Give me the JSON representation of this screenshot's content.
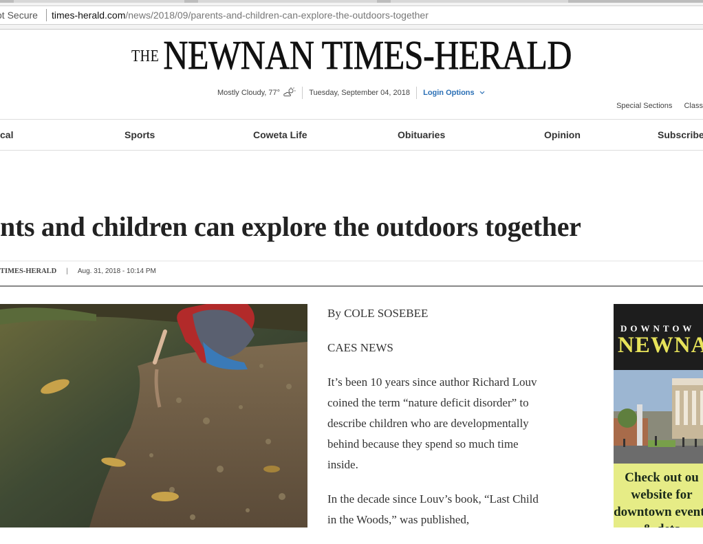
{
  "browser": {
    "security_label": "ot Secure",
    "url_host": "times-herald.com",
    "url_path": "/news/2018/09/parents-and-children-can-explore-the-outdoors-together"
  },
  "masthead": {
    "logo_prefix": "THE",
    "logo_name": "NEWNAN TIMES-HERALD",
    "weather": "Mostly Cloudy, 77°",
    "date": "Tuesday, September 04, 2018",
    "login": "Login Options",
    "utility_links": [
      "Special Sections",
      "Class"
    ]
  },
  "nav": {
    "items": [
      "cal",
      "Sports",
      "Coweta Life",
      "Obituaries",
      "Opinion",
      "Subscribe"
    ]
  },
  "article": {
    "headline": "nts and children can explore the outdoors together",
    "source": "TIMES-HERALD",
    "separator": "|",
    "timestamp": "Aug. 31, 2018 - 10:14 PM",
    "paragraphs": [
      "By COLE SOSEBEE",
      "CAES NEWS",
      "It’s been 10 years since author Richard Louv coined the term “nature deficit disorder” to describe children who are developmentally behind because they spend so much time inside.",
      "In the decade since Louv’s book, “Last Child in the Woods,” was published,"
    ]
  },
  "ad": {
    "kicker": "DOWNTOW",
    "title": "NEWNA",
    "text": "Check out ou website for downtown events & deta"
  },
  "colors": {
    "link_blue": "#2a6fb5",
    "ad_yellow": "#e7e35a",
    "ad_green": "#e6ec86"
  },
  "icons": [
    "chevron-down-icon",
    "partly-cloudy-icon"
  ]
}
